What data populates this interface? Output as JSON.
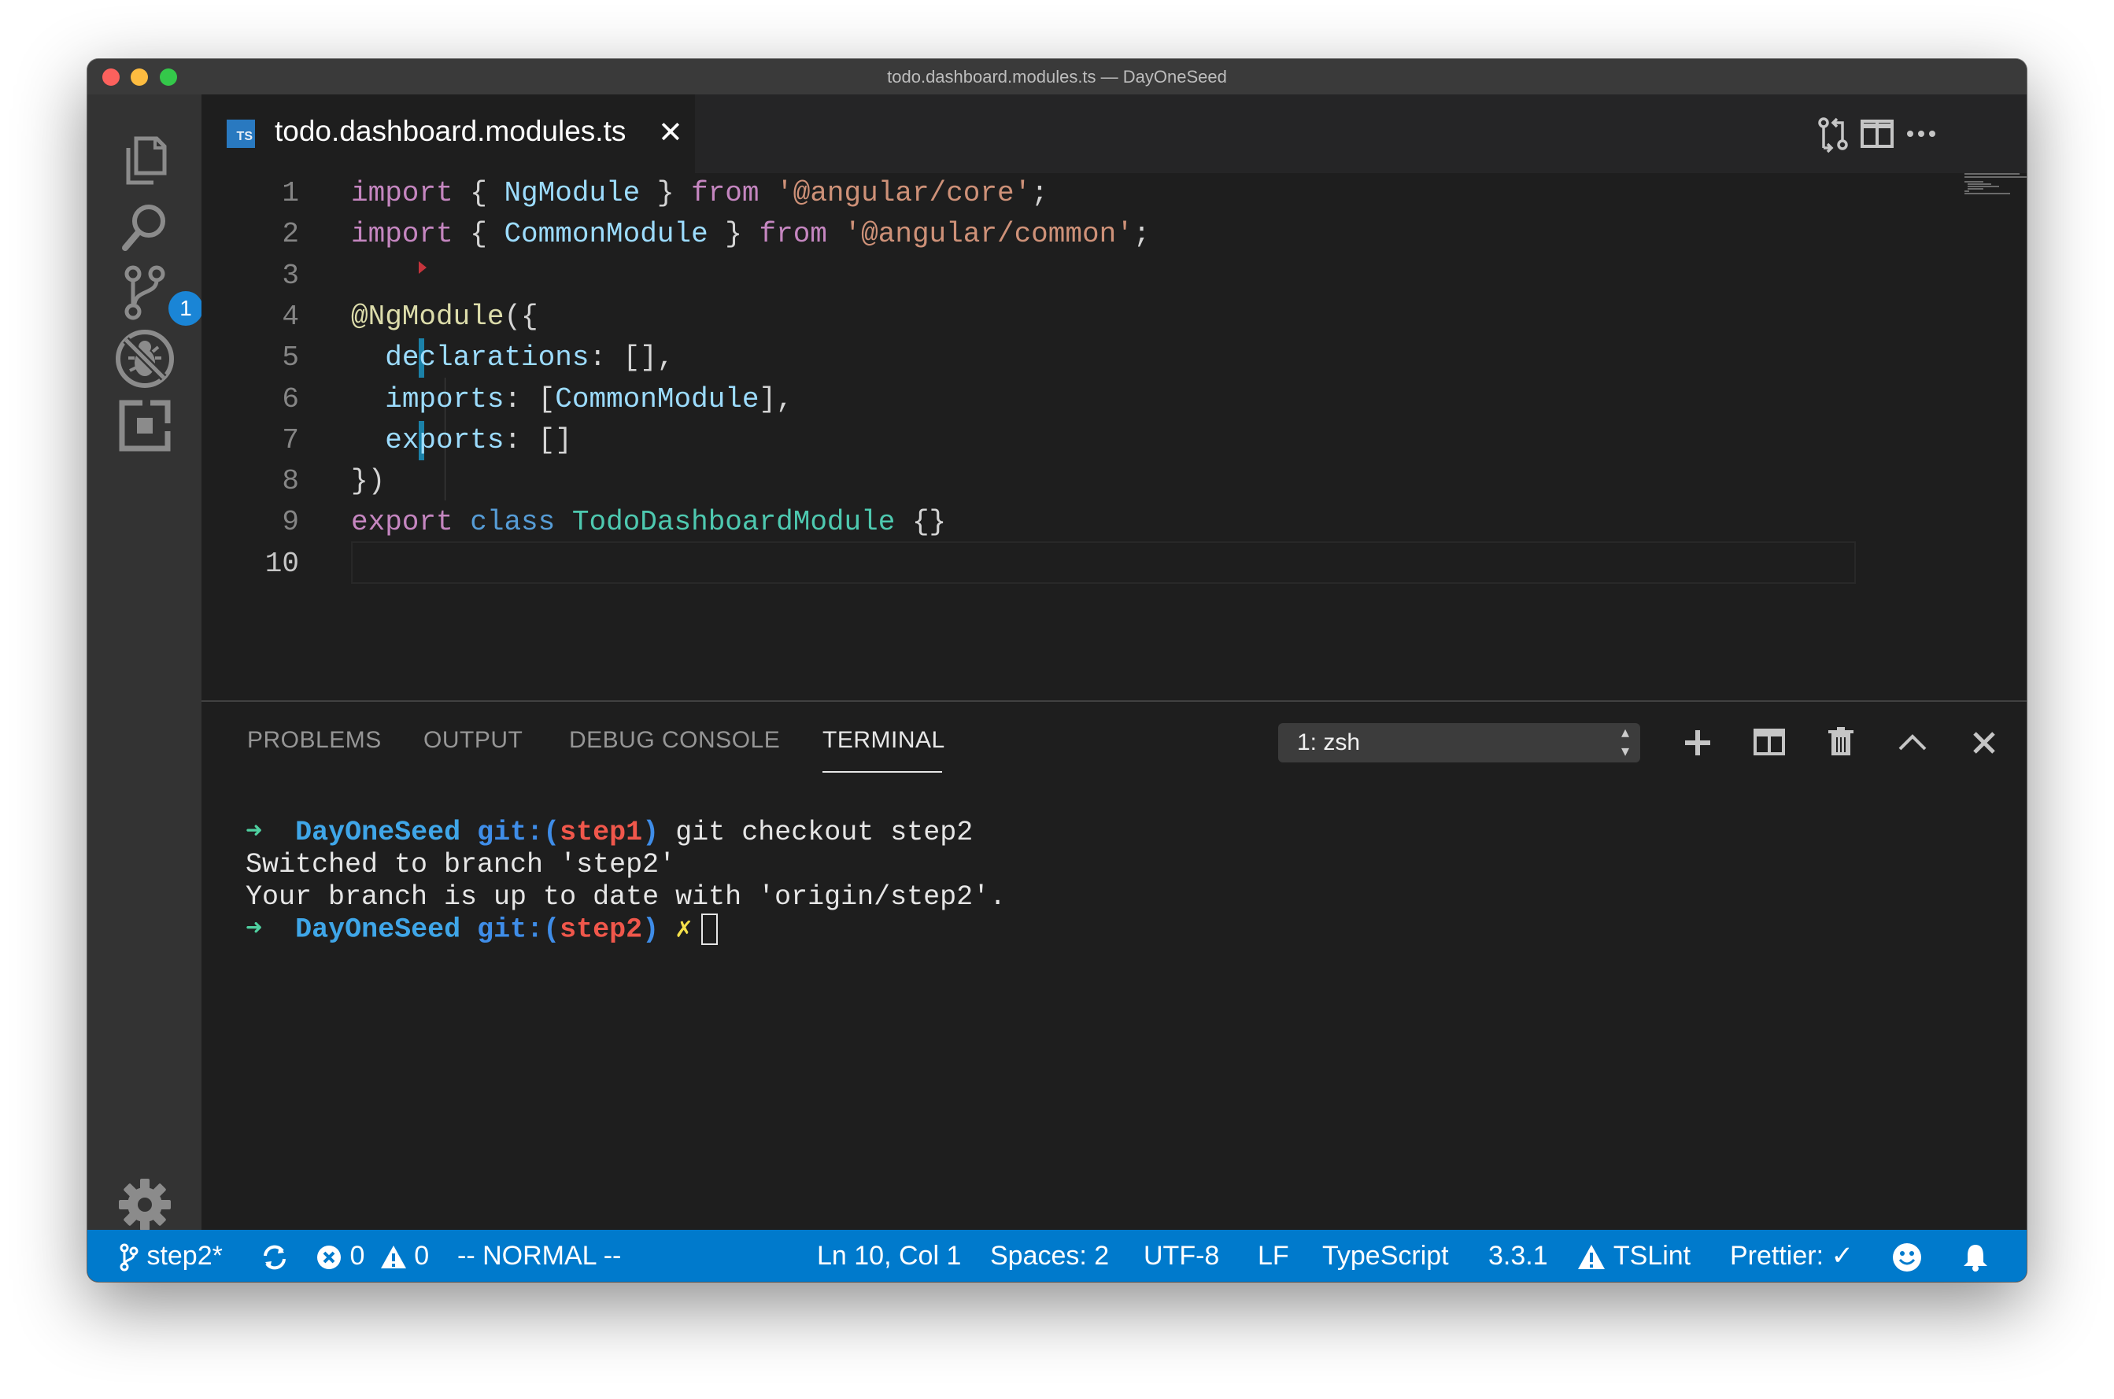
{
  "window": {
    "title": "todo.dashboard.modules.ts — DayOneSeed"
  },
  "activity_bar": {
    "items": [
      "explorer-icon",
      "search-icon",
      "source-control-icon",
      "debug-icon",
      "extensions-icon",
      "settings-gear-icon"
    ],
    "source_control_badge": "1"
  },
  "tabs": [
    {
      "icon": "TS",
      "label": "todo.dashboard.modules.ts",
      "close": "✕",
      "active": true
    }
  ],
  "editor_actions": [
    "open-changes-icon",
    "split-editor-icon",
    "more-actions-icon"
  ],
  "editor": {
    "line_numbers": [
      "1",
      "2",
      "3",
      "4",
      "5",
      "6",
      "7",
      "8",
      "9",
      "10"
    ],
    "active_line": "10",
    "lines": [
      [
        {
          "t": "import",
          "c": "kw"
        },
        {
          "t": " { ",
          "c": "pun"
        },
        {
          "t": "NgModule",
          "c": "id"
        },
        {
          "t": " } ",
          "c": "pun"
        },
        {
          "t": "from",
          "c": "kw"
        },
        {
          "t": " ",
          "c": "pun"
        },
        {
          "t": "'@angular/core'",
          "c": "str"
        },
        {
          "t": ";",
          "c": "pun"
        }
      ],
      [
        {
          "t": "import",
          "c": "kw"
        },
        {
          "t": " { ",
          "c": "pun"
        },
        {
          "t": "CommonModule",
          "c": "id"
        },
        {
          "t": " } ",
          "c": "pun"
        },
        {
          "t": "from",
          "c": "kw"
        },
        {
          "t": " ",
          "c": "pun"
        },
        {
          "t": "'@angular/common'",
          "c": "str"
        },
        {
          "t": ";",
          "c": "pun"
        }
      ],
      [],
      [
        {
          "t": "@NgModule",
          "c": "dec"
        },
        {
          "t": "({",
          "c": "pun"
        }
      ],
      [
        {
          "t": "  ",
          "c": "pun"
        },
        {
          "t": "declarations",
          "c": "id"
        },
        {
          "t": ": [],",
          "c": "pun"
        }
      ],
      [
        {
          "t": "  ",
          "c": "pun"
        },
        {
          "t": "imports",
          "c": "id"
        },
        {
          "t": ": [",
          "c": "pun"
        },
        {
          "t": "CommonModule",
          "c": "id"
        },
        {
          "t": "],",
          "c": "pun"
        }
      ],
      [
        {
          "t": "  ",
          "c": "pun"
        },
        {
          "t": "exports",
          "c": "id"
        },
        {
          "t": ": []",
          "c": "pun"
        }
      ],
      [
        {
          "t": "})",
          "c": "pun"
        }
      ],
      [
        {
          "t": "export",
          "c": "kw"
        },
        {
          "t": " ",
          "c": "pun"
        },
        {
          "t": "class",
          "c": "kw2"
        },
        {
          "t": " ",
          "c": "pun"
        },
        {
          "t": "TodoDashboardModule",
          "c": "cls"
        },
        {
          "t": " {}",
          "c": "pun"
        }
      ],
      []
    ]
  },
  "panel": {
    "tabs": [
      {
        "label": "PROBLEMS",
        "active": false
      },
      {
        "label": "OUTPUT",
        "active": false
      },
      {
        "label": "DEBUG CONSOLE",
        "active": false
      },
      {
        "label": "TERMINAL",
        "active": true
      }
    ],
    "terminal_select": "1: zsh",
    "actions": [
      "new-terminal-icon",
      "split-terminal-icon",
      "kill-terminal-icon",
      "maximize-panel-icon",
      "close-panel-icon"
    ],
    "terminal_lines": [
      [
        {
          "t": "➜  ",
          "c": "t-arrow"
        },
        {
          "t": "DayOneSeed ",
          "c": "t-dir"
        },
        {
          "t": "git:(",
          "c": "t-git"
        },
        {
          "t": "step1",
          "c": "t-branch"
        },
        {
          "t": ")",
          "c": "t-git"
        },
        {
          "t": " git checkout step2",
          "c": ""
        }
      ],
      [
        {
          "t": "Switched to branch 'step2'",
          "c": ""
        }
      ],
      [
        {
          "t": "Your branch is up to date with 'origin/step2'.",
          "c": ""
        }
      ],
      [
        {
          "t": "➜  ",
          "c": "t-arrow"
        },
        {
          "t": "DayOneSeed ",
          "c": "t-dir"
        },
        {
          "t": "git:(",
          "c": "t-git"
        },
        {
          "t": "step2",
          "c": "t-branch"
        },
        {
          "t": ")",
          "c": "t-git"
        },
        {
          "t": " ✗",
          "c": "t-x"
        }
      ]
    ]
  },
  "status_bar": {
    "branch": "step2*",
    "errors": "0",
    "warnings": "0",
    "vim_mode": "-- NORMAL --",
    "position": "Ln 10, Col 1",
    "indent": "Spaces: 2",
    "encoding": "UTF-8",
    "eol": "LF",
    "language": "TypeScript",
    "ts_version": "3.3.1",
    "linter": "TSLint",
    "formatter": "Prettier: ✓"
  },
  "colors": {
    "status_bar": "#007acc",
    "activity_bar": "#333333",
    "editor_bg": "#1e1e1e",
    "badge": "#1a85d6"
  }
}
